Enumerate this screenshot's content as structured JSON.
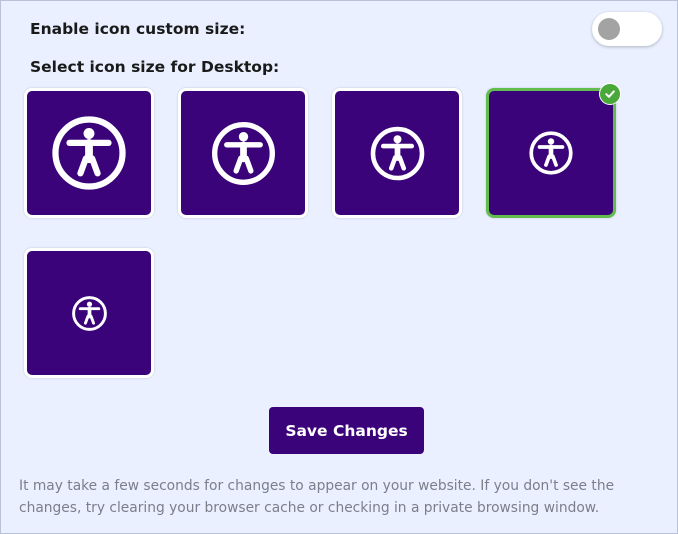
{
  "settings": {
    "toggle_label": "Enable icon custom size:",
    "toggle_state": "off",
    "size_label": "Select icon size for Desktop:"
  },
  "icon_sizes": [
    {
      "option": 1,
      "selected": false
    },
    {
      "option": 2,
      "selected": false
    },
    {
      "option": 3,
      "selected": false
    },
    {
      "option": 4,
      "selected": true
    },
    {
      "option": 5,
      "selected": false
    }
  ],
  "actions": {
    "save_label": "Save Changes"
  },
  "footer": {
    "hint": "It may take a few seconds for changes to appear on your website. If you don't see the changes, try clearing your browser cache or checking in a private browsing window."
  },
  "colors": {
    "background": "#eaf0ff",
    "brand_purple": "#3a037a",
    "selected_border": "#62bd4e",
    "check_badge": "#4aa83a",
    "toggle_knob_off": "#a3a3a3",
    "hint_text": "#7b7f8a"
  },
  "icons": {
    "tile_icon": "accessibility-icon",
    "selected_marker": "checkmark-icon"
  }
}
